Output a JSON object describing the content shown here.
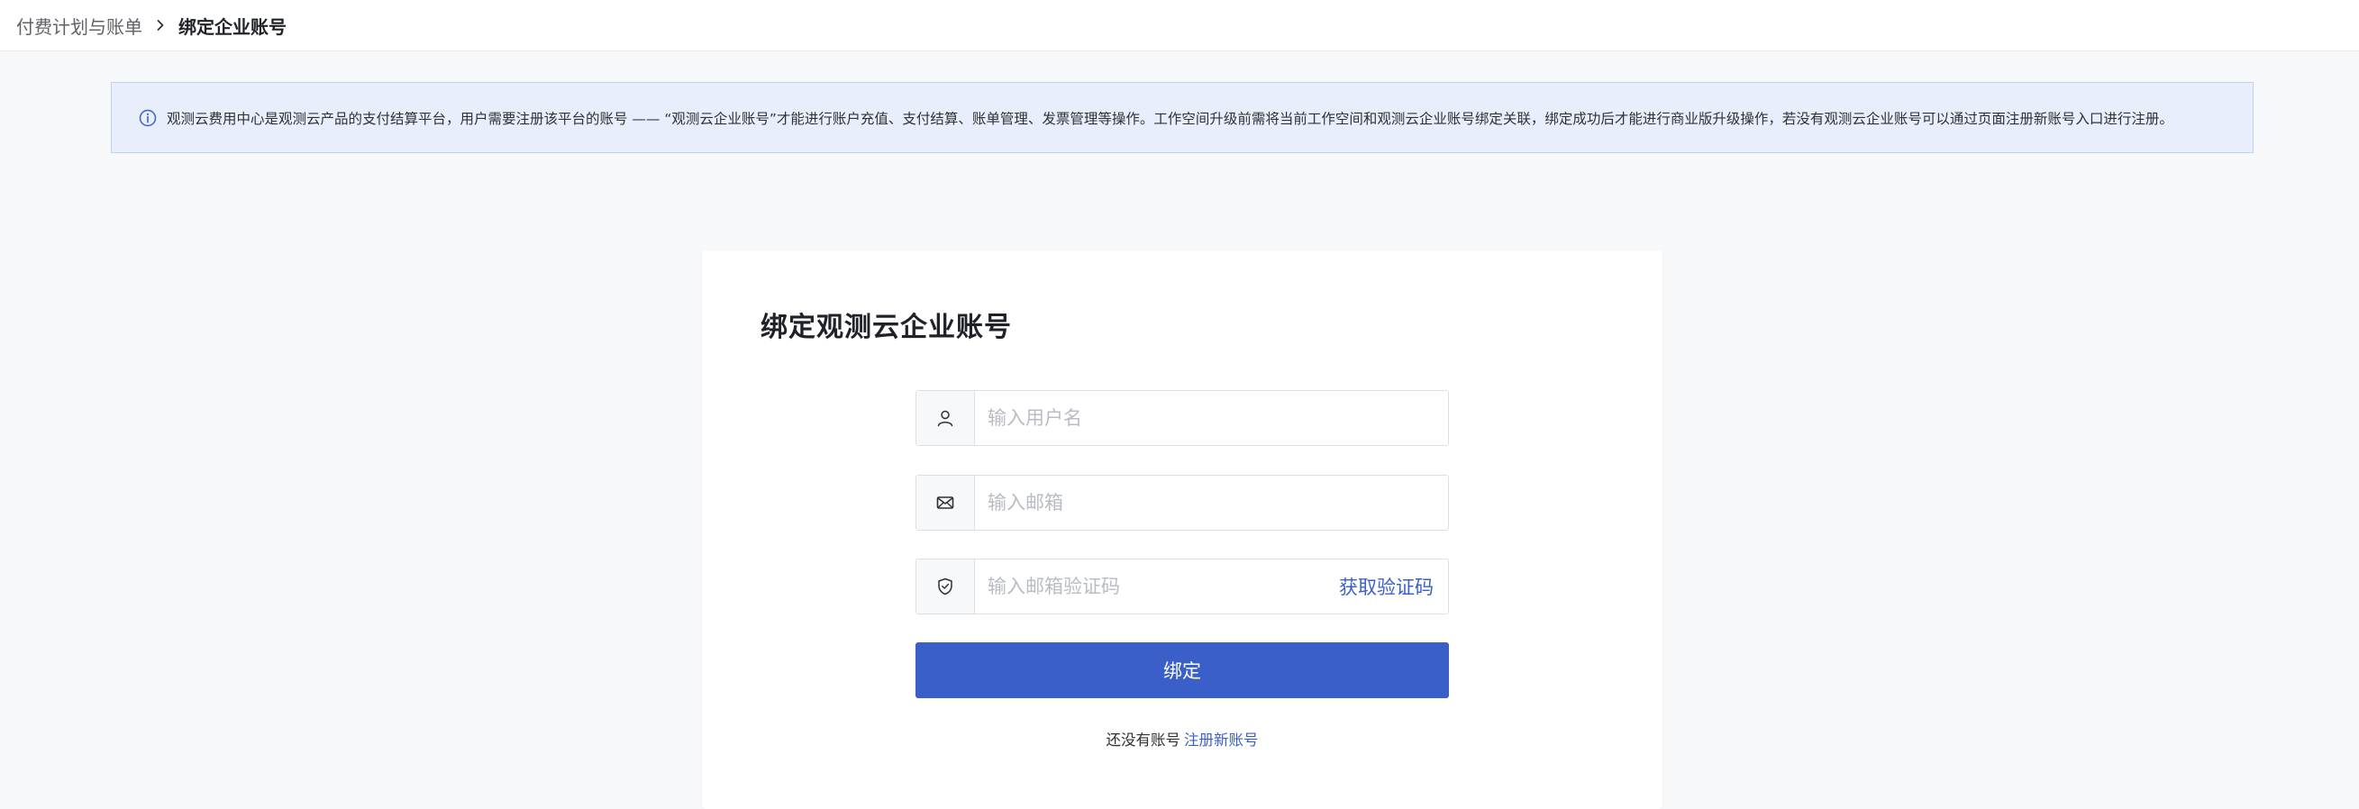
{
  "breadcrumb": {
    "parent": "付费计划与账单",
    "separator_icon": "chevron-right-icon",
    "current": "绑定企业账号"
  },
  "notice": {
    "icon": "info-circle-icon",
    "text": "观测云费用中心是观测云产品的支付结算平台，用户需要注册该平台的账号 —— “观测云企业账号”才能进行账户充值、支付结算、账单管理、发票管理等操作。工作空间升级前需将当前工作空间和观测云企业账号绑定关联，绑定成功后才能进行商业版升级操作，若没有观测云企业账号可以通过页面注册新账号入口进行注册。"
  },
  "form": {
    "title": "绑定观测云企业账号",
    "username": {
      "icon": "user-icon",
      "value": "",
      "placeholder": "输入用户名"
    },
    "email": {
      "icon": "mail-icon",
      "value": "",
      "placeholder": "输入邮箱"
    },
    "code": {
      "icon": "shield-check-icon",
      "value": "",
      "placeholder": "输入邮箱验证码",
      "action_label": "获取验证码"
    },
    "submit_label": "绑定",
    "register_prompt": "还没有账号",
    "register_link": "注册新账号"
  },
  "colors": {
    "primary": "#3b5fc8",
    "notice_background": "#e9eefc",
    "notice_border": "#c3d1f4",
    "page_background": "#f7f8fa"
  }
}
